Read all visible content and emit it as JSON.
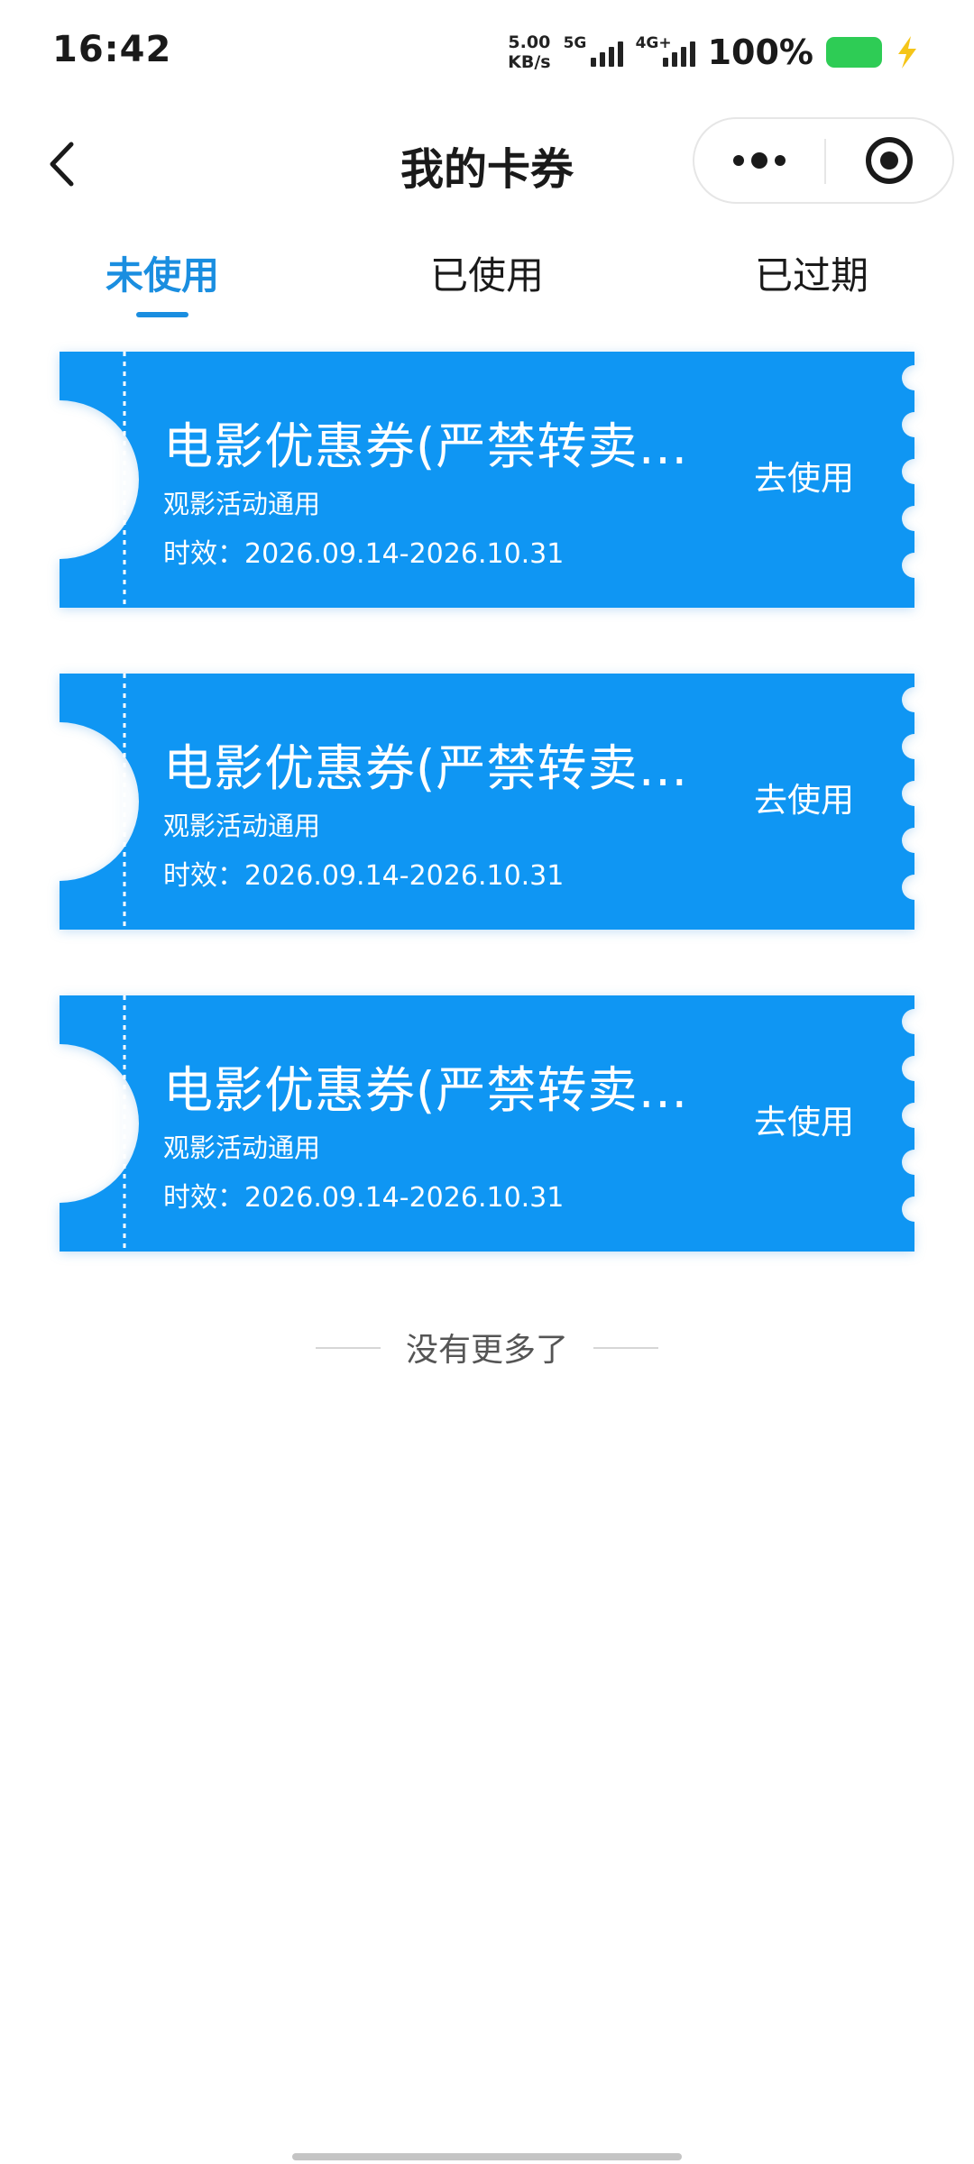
{
  "status_bar": {
    "time": "16:42",
    "net_speed_value": "5.00",
    "net_speed_unit": "KB/s",
    "signal_1_label": "5G",
    "signal_2_label": "4G+",
    "battery_percent": "100%",
    "battery_color": "#2ecc55"
  },
  "nav": {
    "title": "我的卡券",
    "back_icon": "chevron-left-icon",
    "more_icon": "more-dots-icon",
    "close_icon": "target-circle-icon"
  },
  "tabs": [
    {
      "label": "未使用",
      "active": true
    },
    {
      "label": "已使用",
      "active": false
    },
    {
      "label": "已过期",
      "active": false
    }
  ],
  "coupons": [
    {
      "title": "电影优惠券(严禁转卖…",
      "subtitle": "观影活动通用",
      "validity": "时效：2026.09.14-2026.10.31",
      "action": "去使用"
    },
    {
      "title": "电影优惠券(严禁转卖…",
      "subtitle": "观影活动通用",
      "validity": "时效：2026.09.14-2026.10.31",
      "action": "去使用"
    },
    {
      "title": "电影优惠券(严禁转卖…",
      "subtitle": "观影活动通用",
      "validity": "时效：2026.09.14-2026.10.31",
      "action": "去使用"
    }
  ],
  "end_of_list": "没有更多了",
  "colors": {
    "accent": "#1a8ee0",
    "coupon_bg": "#0f96f3",
    "text": "#1a1a1a"
  }
}
